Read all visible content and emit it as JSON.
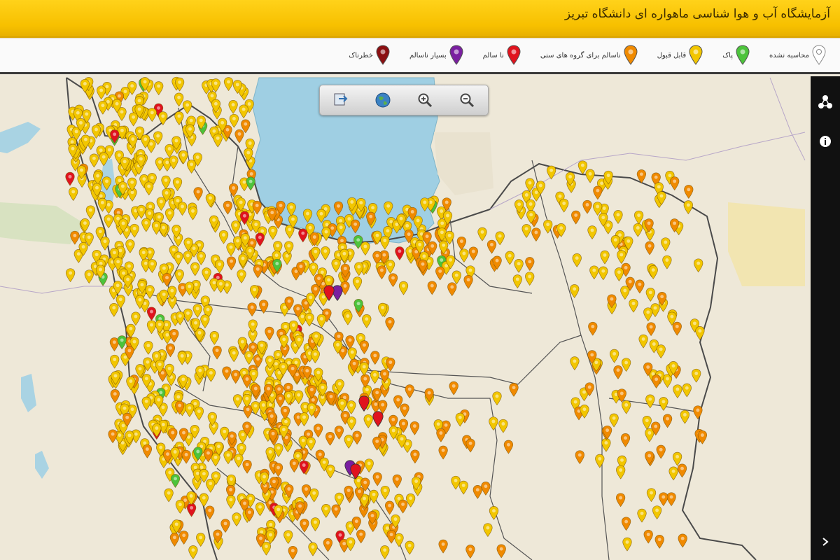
{
  "header": {
    "title": "آزمایشگاه آب و هوا شناسی ماهواره ای دانشگاه تبریز"
  },
  "legend": {
    "items": [
      {
        "label": "محاسبه نشده",
        "color": "#ffffff",
        "icon": "map-pin-outline-icon"
      },
      {
        "label": "پاک",
        "color": "#4cc33b",
        "icon": "map-pin-icon"
      },
      {
        "label": "قابل قبول",
        "color": "#f2c600",
        "icon": "map-pin-icon"
      },
      {
        "label": "ناسالم برای گروه های سنی",
        "color": "#f08a00",
        "icon": "map-pin-icon"
      },
      {
        "label": "نا سالم",
        "color": "#e0131e",
        "icon": "map-pin-icon"
      },
      {
        "label": "بسیار ناسالم",
        "color": "#7a1fa0",
        "icon": "map-pin-icon"
      },
      {
        "label": "خطرناک",
        "color": "#8b0f12",
        "icon": "map-pin-icon"
      }
    ]
  },
  "map_toolbar": {
    "buttons": [
      {
        "name": "layers-export-button",
        "icon": "export-map-icon"
      },
      {
        "name": "globe-button",
        "icon": "globe-icon"
      },
      {
        "name": "zoom-in-button",
        "icon": "zoom-in-icon"
      },
      {
        "name": "zoom-out-button",
        "icon": "zoom-out-icon"
      }
    ]
  },
  "side_panel": {
    "buttons": [
      {
        "name": "share-button",
        "icon": "share-icon"
      },
      {
        "name": "info-button",
        "icon": "info-icon"
      },
      {
        "name": "collapse-button",
        "icon": "chevron-right-icon"
      }
    ]
  },
  "colors": {
    "header_bg": "#f7c000",
    "water": "#9fcfe3",
    "land": "#eee8d8",
    "border": "#4a4a4a"
  }
}
